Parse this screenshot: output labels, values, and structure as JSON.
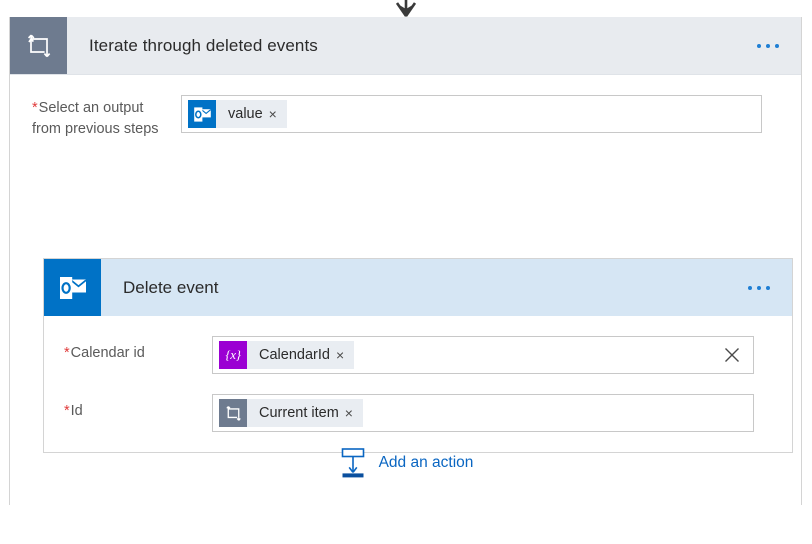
{
  "connector": {
    "arrow_icon": "arrow-down-icon"
  },
  "loop": {
    "icon": "loop-icon",
    "title": "Iterate through deleted events",
    "menu_label": "•••",
    "field": {
      "label_line1": "Select an output",
      "label_line2": "from previous steps",
      "required_marker": "*",
      "token": {
        "icon": "outlook-icon",
        "label": "value",
        "remove_label": "×"
      }
    }
  },
  "action": {
    "icon": "outlook-icon",
    "title": "Delete event",
    "menu_label": "•••",
    "fields": [
      {
        "label": "Calendar id",
        "required_marker": "*",
        "token": {
          "icon": "expression-icon",
          "icon_glyph": "{x}",
          "label": "CalendarId",
          "remove_label": "×"
        },
        "clear_icon": "close-icon",
        "has_clear": true
      },
      {
        "label": "Id",
        "required_marker": "*",
        "token": {
          "icon": "loop-icon",
          "label": "Current item",
          "remove_label": "×"
        },
        "has_clear": false
      }
    ]
  },
  "add_action": {
    "icon": "add-action-icon",
    "label": "Add an action"
  },
  "colors": {
    "loop_accent": "#6e7b8f",
    "outlook_blue": "#0072c6",
    "expression_purple": "#9b00d3",
    "link_blue": "#0a66c2",
    "required_red": "#e03a3a",
    "loop_header_bg": "#e8ebef",
    "action_header_bg": "#d6e6f4",
    "chip_bg": "#e9edf2"
  }
}
